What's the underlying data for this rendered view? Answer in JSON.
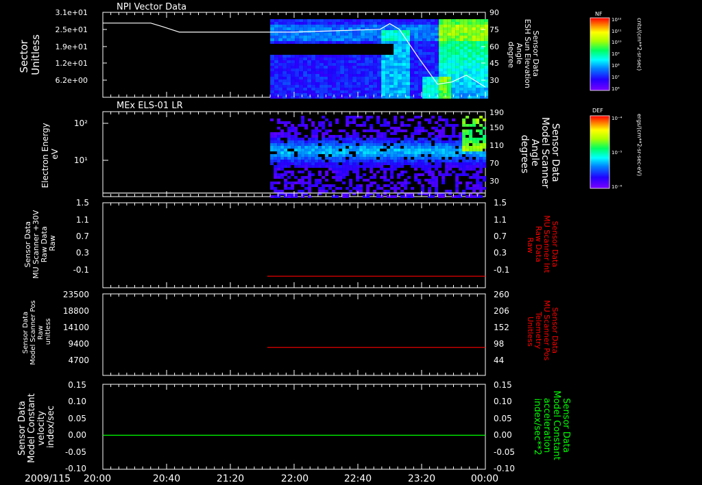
{
  "time_axis": {
    "date": "2009/115",
    "ticks": [
      "20:00",
      "20:40",
      "21:20",
      "22:00",
      "22:40",
      "23:20",
      "00:00"
    ],
    "range_hours": [
      20,
      24
    ]
  },
  "colorbars": [
    {
      "label": "NF",
      "units": "cnts/(cm**2-sr-sec)",
      "ticks": [
        "10¹²",
        "10¹¹",
        "10¹⁰",
        "10⁹",
        "10⁸",
        "10⁷",
        "10⁶"
      ]
    },
    {
      "label": "DEF",
      "units": "ergs/(cm**2-sr-sec-eV)",
      "ticks": [
        "10⁻⁴",
        "10⁻⁵",
        "10⁻⁶"
      ]
    }
  ],
  "chart_data": [
    {
      "type": "heatmap",
      "title": "NPI Vector Data",
      "ylabel": [
        "Sector",
        "Unitless"
      ],
      "y_ticks": [
        "3.1e+01",
        "2.5e+01",
        "1.9e+01",
        "1.2e+01",
        "6.2e+00"
      ],
      "right_ylabel": [
        "Sensor Data",
        "ESH Sun Elevation",
        "Angle",
        "degree"
      ],
      "right_ticks": [
        "90",
        "75",
        "60",
        "45",
        "30"
      ],
      "right_ylim": [
        15,
        90
      ],
      "data_start_hour": 21.75,
      "line_color": "#ffffff",
      "line": {
        "x": [
          20.0,
          20.5,
          20.62,
          20.8,
          21.0,
          22.0,
          22.9,
          23.0,
          23.1,
          23.3,
          23.5,
          23.65,
          23.8,
          24.0
        ],
        "y": [
          80.5,
          80.5,
          77.5,
          72.5,
          72.5,
          72.5,
          75,
          80,
          75,
          50,
          26.5,
          28.5,
          34.5,
          24
        ]
      }
    },
    {
      "type": "heatmap",
      "title": "MEx ELS-01 LR",
      "ylabel": [
        "Electron Energy",
        "eV"
      ],
      "y_ticks": [
        "10²",
        "10¹"
      ],
      "y_scale": "log",
      "ylim": [
        1.5,
        180
      ],
      "right_ylabel": [
        "Sensor Data",
        "Model Scanner",
        "Angle",
        "degrees"
      ],
      "right_ticks": [
        "190",
        "150",
        "110",
        "70",
        "30"
      ],
      "right_ylim": [
        0,
        190
      ],
      "data_start_hour": 21.75,
      "line_color": "#ffffff",
      "line": {
        "x": [
          20.0,
          24.0
        ],
        "y": [
          8,
          8
        ]
      }
    },
    {
      "type": "line",
      "ylabel": [
        "Sensor Data",
        "MU Scanner +30V",
        "Raw Data",
        "Raw"
      ],
      "y_ticks": [
        "1.5",
        "1.1",
        "0.7",
        "0.3",
        "-0.1"
      ],
      "ylim": [
        -0.35,
        1.5
      ],
      "right_ylabel": [
        "Sensor Data",
        "MU Scanner Int",
        "Raw Data",
        "Raw"
      ],
      "right_ticks": [
        "1.5",
        "1.1",
        "0.7",
        "0.3",
        "-0.1"
      ],
      "right_label_color": "#ff0000",
      "series": [
        {
          "color": "#ff0000",
          "x": [
            21.72,
            24.0
          ],
          "y": [
            -0.1,
            -0.1
          ]
        }
      ]
    },
    {
      "type": "line",
      "ylabel": [
        "Sensor Data",
        "Model Scanner Pos",
        "Raw",
        "unitless"
      ],
      "y_ticks": [
        "23500",
        "18800",
        "14100",
        "9400",
        "4700"
      ],
      "ylim": [
        0,
        23500
      ],
      "right_ylabel": [
        "Sensor Data",
        "MU Scanner Pos",
        "Telemetry",
        "Unitless"
      ],
      "right_ticks": [
        "260",
        "206",
        "152",
        "98",
        "44"
      ],
      "right_label_color": "#ff0000",
      "series": [
        {
          "color": "#ff0000",
          "x": [
            21.72,
            24.0
          ],
          "y": [
            8060,
            8060
          ]
        }
      ]
    },
    {
      "type": "line",
      "ylabel": [
        "Sensor Data",
        "Model Constant",
        "velocity",
        "index/sec"
      ],
      "y_ticks": [
        "0.15",
        "0.10",
        "0.05",
        "0.00",
        "-0.05",
        "-0.10"
      ],
      "ylim": [
        -0.1,
        0.15
      ],
      "right_ylabel": [
        "Sensor Data",
        "Model Constant",
        "acceleration",
        "index/sec**2"
      ],
      "right_ticks": [
        "0.15",
        "0.10",
        "0.05",
        "0.00",
        "-0.05",
        "-0.10"
      ],
      "right_label_color": "#00ff00",
      "series": [
        {
          "color": "#00ff00",
          "x": [
            20.0,
            24.0
          ],
          "y": [
            0.0,
            0.0
          ]
        }
      ]
    }
  ]
}
